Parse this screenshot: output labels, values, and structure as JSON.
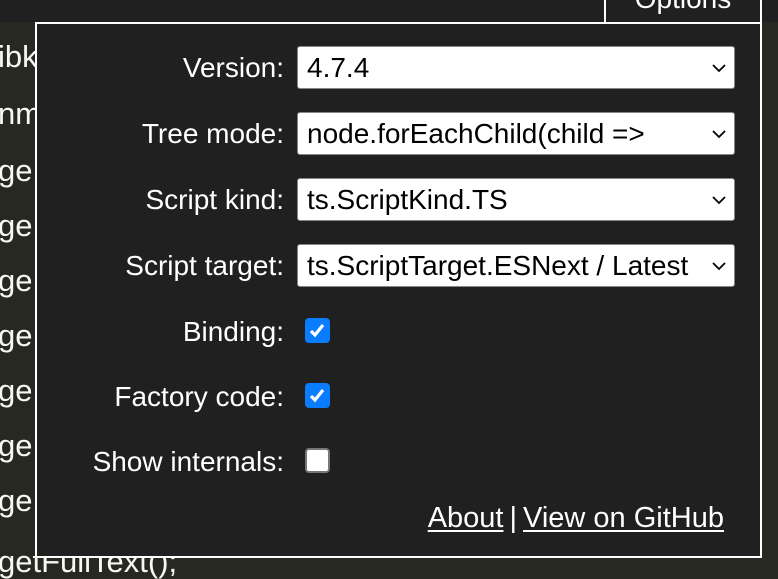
{
  "background_code": {
    "lines": [
      "ibk",
      "nm",
      "ge",
      "ge",
      "ge",
      "ge",
      "ge",
      "ge",
      "ge",
      "getFullText();"
    ]
  },
  "options_tab": {
    "label": "Options"
  },
  "options": {
    "version": {
      "label": "Version:",
      "value": "4.7.4"
    },
    "tree_mode": {
      "label": "Tree mode:",
      "value": "node.forEachChild(child =>"
    },
    "script_kind": {
      "label": "Script kind:",
      "value": "ts.ScriptKind.TS"
    },
    "script_target": {
      "label": "Script target:",
      "value": "ts.ScriptTarget.ESNext / Latest"
    },
    "binding": {
      "label": "Binding:",
      "checked": true
    },
    "factory_code": {
      "label": "Factory code:",
      "checked": true
    },
    "show_internals": {
      "label": "Show internals:",
      "checked": false
    }
  },
  "links": {
    "about": "About",
    "separator": "|",
    "github": "View on GitHub"
  },
  "colors": {
    "accent": "#0a7cff",
    "panel": "#202020",
    "editor_bg": "#272822"
  }
}
